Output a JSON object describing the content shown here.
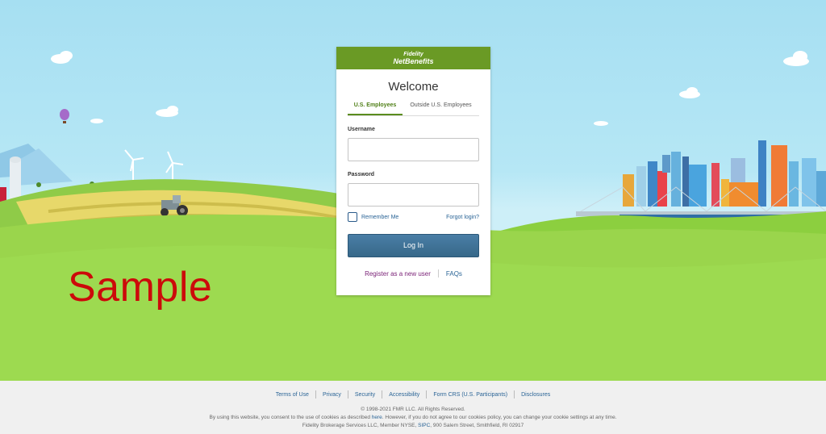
{
  "brand": {
    "line1": "Fidelity",
    "line2": "NetBenefits"
  },
  "login": {
    "title": "Welcome",
    "tabs": [
      {
        "label": "U.S. Employees",
        "active": true
      },
      {
        "label": "Outside U.S. Employees",
        "active": false
      }
    ],
    "username_label": "Username",
    "username_value": "",
    "password_label": "Password",
    "password_value": "",
    "remember_label": "Remember Me",
    "remember_checked": false,
    "forgot_label": "Forgot login?",
    "submit_label": "Log In",
    "register_label": "Register as a new user",
    "faqs_label": "FAQs"
  },
  "watermark": "Sample",
  "footer": {
    "links": [
      "Terms of Use",
      "Privacy",
      "Security",
      "Accessibility",
      "Form CRS (U.S. Participants)",
      "Disclosures"
    ],
    "copyright": "© 1998-2021 FMR LLC. All Rights Reserved.",
    "cookie_before": "By using this website, you consent to the use of cookies as described",
    "cookie_link": "here",
    "cookie_after": ". However, if you do not agree to our cookies policy, you can change your cookie settings at any time.",
    "broker_before": "Fidelity Brokerage Services LLC, Member NYSE,",
    "broker_link": "SIPC",
    "broker_after": ", 900 Salem Street, Smithfield, RI 02917"
  },
  "colors": {
    "header_green": "#6a9a25",
    "tab_active": "#4f7f16",
    "button_blue": "#3f7199",
    "link_blue": "#2a6496",
    "register_purple": "#7b2378",
    "watermark_red": "#cc0a0a",
    "grass": "#9bd94f"
  },
  "icons": [
    "hot-air-balloon-icon",
    "wind-turbine-icon",
    "tractor-icon",
    "cloud-icon",
    "city-skyline-icon",
    "bridge-icon"
  ]
}
